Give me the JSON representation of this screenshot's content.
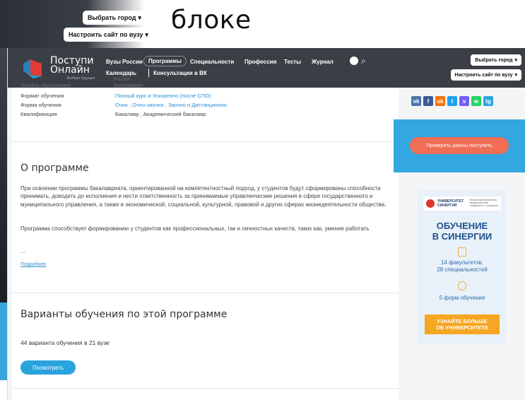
{
  "slide": {
    "word": "блоке",
    "choose_city": "Выбрать город",
    "customize_site": "Настроить сайт по вузу"
  },
  "logo": {
    "line1": "Поступи",
    "line2": "Онлайн",
    "tagline": "Выбери будущее"
  },
  "nav": {
    "items": [
      "Вузы России",
      "Программы",
      "Специальности",
      "Профессии",
      "Тесты",
      "Журнал"
    ],
    "row2": [
      "Календарь",
      "Консультации в ВК"
    ],
    "active": "Программы",
    "choose_city": "Выбрать город",
    "customize_site": "Настроить сайт по вузу"
  },
  "faint": {
    "under_nav_1": "Россия",
    "under_nav_2": "Бакалавриат",
    "under_left": "Уровень образования"
  },
  "info": {
    "rows": [
      {
        "label": "Формат обучения",
        "value": "Полный курс  и Ускоренно (после СПО)"
      },
      {
        "label": "Форма обучения",
        "value": "Очно , Очно-заочно , Заочно  и Дистанционно"
      },
      {
        "label": "Квалификация",
        "value": "Бакалавр ,  Академический бакалавр"
      }
    ]
  },
  "about": {
    "heading": "О программе",
    "p1": "При освоении программы бакалавриата, ориентированной на компетентностный подход, у студентов будут сформированы способности принимать, доводить до исполнения и нести ответственность за принимаемые управленческие решения в сфере государственного и муниципального управления, а также в экономической, социальной, культурной, правовой и других сферах жизнедеятельности общества.",
    "p2": "Программа способствует формированию у студентов как профессиональных, так и личностных качеств, таких как, умение работать",
    "ellipsis": "...",
    "more": "Подробнее"
  },
  "variants": {
    "heading": "Варианты обучения по этой программе",
    "count_number": "44",
    "count_text": "варианта обучения в",
    "vuz_number": "21",
    "vuz_text": "вузе",
    "button": "Посмотреть"
  },
  "sidebar": {
    "social": [
      {
        "name": "vk",
        "label": "vk",
        "color": "#4a76a8"
      },
      {
        "name": "facebook",
        "label": "f",
        "color": "#3b5998"
      },
      {
        "name": "odnoklassniki",
        "label": "ok",
        "color": "#f2720c"
      },
      {
        "name": "twitter",
        "label": "t",
        "color": "#1da1f2"
      },
      {
        "name": "viber",
        "label": "v",
        "color": "#7360f2"
      },
      {
        "name": "whatsapp",
        "label": "w",
        "color": "#25d366"
      },
      {
        "name": "telegram",
        "label": "tg",
        "color": "#2ca5e0"
      }
    ],
    "check_button": "Проверить шансы поступить",
    "ad": {
      "logo_line1": "УНИВЕРСИТЕТ",
      "logo_line2": "СИНЕРГИЯ",
      "logo_small": "Московский финансово-промышленный университет «Синергия»",
      "title_line1": "ОБУЧЕНИЕ",
      "title_line2": "В СИНЕРГИИ",
      "stat1_line1": "14 факультетов,",
      "stat1_line2": "28 специальностей",
      "stat2": "5 форм обучения",
      "cta_line1": "УЗНАЙТЕ БОЛЬШЕ",
      "cta_line2": "ОБ УНИВЕРСИТЕТЕ"
    }
  }
}
